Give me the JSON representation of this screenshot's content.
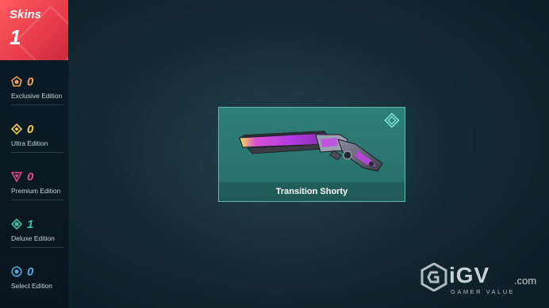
{
  "skins": {
    "title": "Skins",
    "count": "1"
  },
  "editions": [
    {
      "count": "0",
      "label": "Exclusive Edition",
      "color": "#f0a35a",
      "icon": "pentagon-icon"
    },
    {
      "count": "0",
      "label": "Ultra Edition",
      "color": "#f3cf4a",
      "icon": "diamond-icon"
    },
    {
      "count": "0",
      "label": "Premium Edition",
      "color": "#e04a8a",
      "icon": "triangle-icon"
    },
    {
      "count": "1",
      "label": "Deluxe Edition",
      "color": "#3ec2a9",
      "icon": "gem-icon"
    },
    {
      "count": "0",
      "label": "Select Edition",
      "color": "#4fa6e0",
      "icon": "circle-icon"
    }
  ],
  "skin_card": {
    "name": "Transition Shorty",
    "tier_icon": "deluxe-gem-icon",
    "accent": "#2e7f79"
  },
  "watermark": {
    "main": "iGV",
    "suffix": ".com",
    "sub": "GAMER VALUE"
  }
}
